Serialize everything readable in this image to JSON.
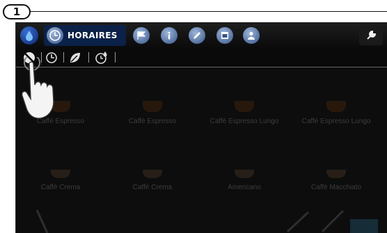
{
  "step": {
    "number": "1"
  },
  "header": {
    "active_tab": {
      "label": "HORAIRES",
      "icon": "clock-icon"
    },
    "tabs": [
      {
        "name": "water-drop-icon"
      },
      {
        "name": "flag-icon"
      },
      {
        "name": "info-icon"
      },
      {
        "name": "pencil-icon"
      },
      {
        "name": "calendar-icon"
      },
      {
        "name": "user-lock-icon"
      },
      {
        "name": "wrench-icon"
      }
    ]
  },
  "subtoolbar": {
    "items": [
      {
        "name": "no-power-icon"
      },
      {
        "name": "timer-icon"
      },
      {
        "name": "leaf-icon"
      },
      {
        "name": "drop-timer-icon"
      }
    ]
  },
  "products": [
    {
      "label": "Caffè Espresso"
    },
    {
      "label": "Caffè Espresso"
    },
    {
      "label": "Caffè Espresso Lungo"
    },
    {
      "label": "Caffè Espresso Lungo"
    },
    {
      "label": "Caffè Crema"
    },
    {
      "label": "Caffè Crema"
    },
    {
      "label": "Americano"
    },
    {
      "label": "Caffè Macchiato"
    }
  ],
  "colors": {
    "active_tab_bg": "#0b2148",
    "screen_bg": "#0d0d0d",
    "accent_blue": "#2a5bc0"
  }
}
